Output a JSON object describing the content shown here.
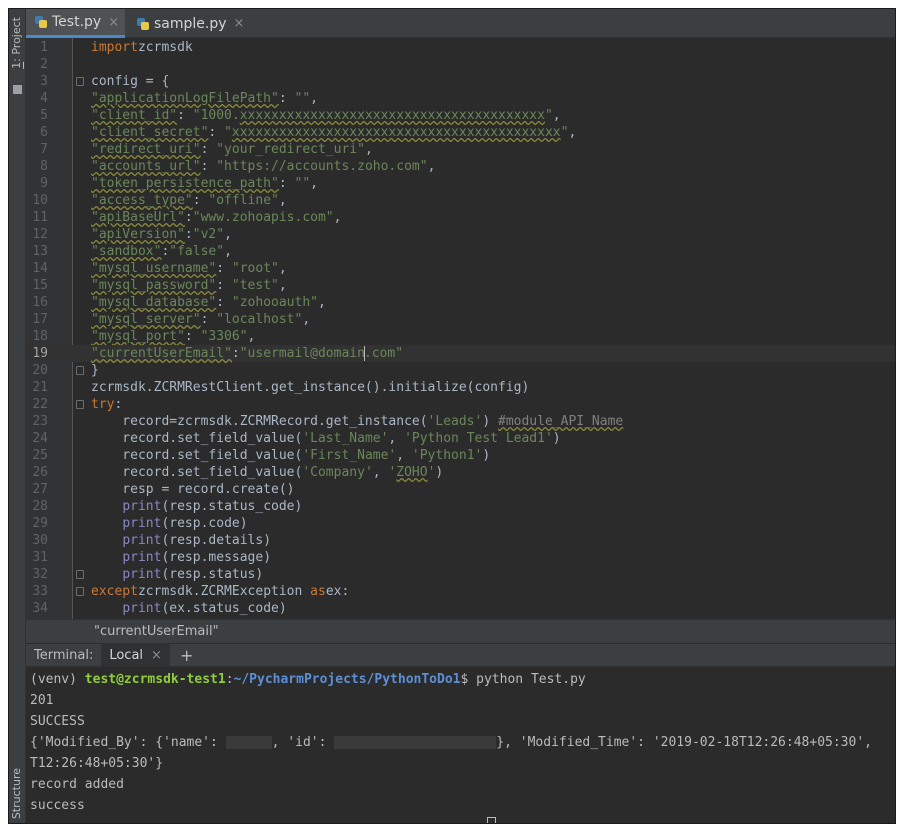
{
  "sidebar": {
    "project_num": "1",
    "project_label": ": Project",
    "structure_label": "Structure"
  },
  "tabs": [
    {
      "label": "Test.py",
      "close": "×"
    },
    {
      "label": "sample.py",
      "close": "×"
    }
  ],
  "editor": {
    "current_line": 19,
    "lines": [
      {
        "n": "1",
        "segs": [
          [
            "kw",
            "import"
          ],
          [
            "",
            "zcrmsdk"
          ]
        ]
      },
      {
        "n": "2",
        "segs": []
      },
      {
        "n": "3",
        "segs": [
          [
            "",
            "config = {"
          ]
        ]
      },
      {
        "n": "4",
        "segs": [
          [
            "sw",
            "\"applicationLogFilePath\""
          ],
          [
            "",
            ": "
          ],
          [
            "str",
            "\"\""
          ],
          [
            "",
            ","
          ]
        ]
      },
      {
        "n": "5",
        "segs": [
          [
            "sw",
            "\"client_id\""
          ],
          [
            "",
            ": "
          ],
          [
            "str",
            "\"1000."
          ],
          [
            "sw",
            "xxxxxxxxxxxxxxxxxxxxxxxxxxxxxxxxxxxxxxx"
          ],
          [
            "str",
            "\""
          ],
          [
            "",
            ","
          ]
        ]
      },
      {
        "n": "6",
        "segs": [
          [
            "sw",
            "\"client_secret\""
          ],
          [
            "",
            ": "
          ],
          [
            "str",
            "\""
          ],
          [
            "sw",
            "xxxxxxxxxxxxxxxxxxxxxxxxxxxxxxxxxxxxxxxxxx"
          ],
          [
            "str",
            "\""
          ],
          [
            "",
            ","
          ]
        ]
      },
      {
        "n": "7",
        "segs": [
          [
            "sw",
            "\"redirect_uri\""
          ],
          [
            "",
            ": "
          ],
          [
            "str",
            "\"your_redirect_uri\""
          ],
          [
            "",
            ","
          ]
        ]
      },
      {
        "n": "8",
        "segs": [
          [
            "sw",
            "\"accounts_url\""
          ],
          [
            "",
            ": "
          ],
          [
            "str",
            "\"https://accounts.zoho.com\""
          ],
          [
            "",
            ","
          ]
        ]
      },
      {
        "n": "9",
        "segs": [
          [
            "sw",
            "\"token_persistence_path\""
          ],
          [
            "",
            ": "
          ],
          [
            "str",
            "\"\""
          ],
          [
            "",
            ","
          ]
        ]
      },
      {
        "n": "10",
        "segs": [
          [
            "sw",
            "\"access_type\""
          ],
          [
            "",
            ": "
          ],
          [
            "str",
            "\"offline\""
          ],
          [
            "",
            ","
          ]
        ]
      },
      {
        "n": "11",
        "segs": [
          [
            "sw",
            "\"apiBaseUrl\""
          ],
          [
            "",
            ":"
          ],
          [
            "str",
            "\"www.zohoapis.com\""
          ],
          [
            "",
            ","
          ]
        ]
      },
      {
        "n": "12",
        "segs": [
          [
            "sw",
            "\"apiVersion\""
          ],
          [
            "",
            ":"
          ],
          [
            "str",
            "\"v2\""
          ],
          [
            "",
            ","
          ]
        ]
      },
      {
        "n": "13",
        "segs": [
          [
            "sw",
            "\"sandbox\""
          ],
          [
            "",
            ":"
          ],
          [
            "str",
            "\"false\""
          ],
          [
            "",
            ","
          ]
        ]
      },
      {
        "n": "14",
        "segs": [
          [
            "sw",
            "\"mysql_username\""
          ],
          [
            "",
            ": "
          ],
          [
            "str",
            "\"root\""
          ],
          [
            "",
            ","
          ]
        ]
      },
      {
        "n": "15",
        "segs": [
          [
            "sw",
            "\"mysql_password\""
          ],
          [
            "",
            ": "
          ],
          [
            "str",
            "\"test\""
          ],
          [
            "",
            ","
          ]
        ]
      },
      {
        "n": "16",
        "segs": [
          [
            "sw",
            "\"mysql_database\""
          ],
          [
            "",
            ": "
          ],
          [
            "str",
            "\"zohooauth\""
          ],
          [
            "",
            ","
          ]
        ]
      },
      {
        "n": "17",
        "segs": [
          [
            "sw",
            "\"mysql_server\""
          ],
          [
            "",
            ": "
          ],
          [
            "str",
            "\"localhost\""
          ],
          [
            "",
            ","
          ]
        ]
      },
      {
        "n": "18",
        "segs": [
          [
            "sw",
            "\"mysql_port\""
          ],
          [
            "",
            ": "
          ],
          [
            "str",
            "\"3306\""
          ],
          [
            "",
            ","
          ]
        ]
      },
      {
        "n": "19",
        "segs": [
          [
            "sw",
            "\"currentUserEmail\""
          ],
          [
            "",
            ":"
          ],
          [
            "str",
            "\"usermail@domain"
          ],
          [
            "caret",
            ""
          ],
          [
            "str",
            ".com\""
          ]
        ]
      },
      {
        "n": "20",
        "segs": [
          [
            "",
            "}"
          ]
        ]
      },
      {
        "n": "21",
        "segs": [
          [
            "",
            "zcrmsdk.ZCRMRestClient.get_instance().initialize(config)"
          ]
        ]
      },
      {
        "n": "22",
        "segs": [
          [
            "kw",
            "try"
          ],
          [
            "",
            ":"
          ]
        ]
      },
      {
        "n": "23",
        "segs": [
          [
            "",
            "    record=zcrmsdk.ZCRMRecord.get_instance("
          ],
          [
            "str",
            "'Leads'"
          ],
          [
            "",
            ") "
          ],
          [
            "cm",
            "#module_API_Name"
          ]
        ]
      },
      {
        "n": "24",
        "segs": [
          [
            "",
            "    record.set_field_value("
          ],
          [
            "str",
            "'Last_Name'"
          ],
          [
            "",
            ", "
          ],
          [
            "str",
            "'Python Test Lead1'"
          ],
          [
            "",
            ")"
          ]
        ]
      },
      {
        "n": "25",
        "segs": [
          [
            "",
            "    record.set_field_value("
          ],
          [
            "str",
            "'First_Name'"
          ],
          [
            "",
            ", "
          ],
          [
            "str",
            "'Python1'"
          ],
          [
            "",
            ")"
          ]
        ]
      },
      {
        "n": "26",
        "segs": [
          [
            "",
            "    record.set_field_value("
          ],
          [
            "str",
            "'Company'"
          ],
          [
            "",
            ", "
          ],
          [
            "str",
            "'"
          ],
          [
            "sw",
            "ZOHO"
          ],
          [
            "str",
            "'"
          ],
          [
            "",
            ")"
          ]
        ]
      },
      {
        "n": "27",
        "segs": [
          [
            "",
            "    resp = record.create()"
          ]
        ]
      },
      {
        "n": "28",
        "segs": [
          [
            "",
            "    "
          ],
          [
            "bi",
            "print"
          ],
          [
            "",
            "(resp.status_code)"
          ]
        ]
      },
      {
        "n": "29",
        "segs": [
          [
            "",
            "    "
          ],
          [
            "bi",
            "print"
          ],
          [
            "",
            "(resp.code)"
          ]
        ]
      },
      {
        "n": "30",
        "segs": [
          [
            "",
            "    "
          ],
          [
            "bi",
            "print"
          ],
          [
            "",
            "(resp.details)"
          ]
        ]
      },
      {
        "n": "31",
        "segs": [
          [
            "",
            "    "
          ],
          [
            "bi",
            "print"
          ],
          [
            "",
            "(resp.message)"
          ]
        ]
      },
      {
        "n": "32",
        "segs": [
          [
            "",
            "    "
          ],
          [
            "bi",
            "print"
          ],
          [
            "",
            "(resp.status)"
          ]
        ]
      },
      {
        "n": "33",
        "segs": [
          [
            "kw",
            "except"
          ],
          [
            "",
            "zcrmsdk.ZCRMException "
          ],
          [
            "kw",
            "as"
          ],
          [
            "",
            "ex:"
          ]
        ]
      },
      {
        "n": "34",
        "segs": [
          [
            "",
            "    "
          ],
          [
            "bi",
            "print"
          ],
          [
            "",
            "(ex.status_code)"
          ]
        ]
      }
    ],
    "fold_lines": [
      3,
      20,
      22,
      32,
      33
    ]
  },
  "breadcrumb": "\"currentUserEmail\"",
  "terminal": {
    "title": "Terminal:",
    "tab": "Local",
    "tab_close": "×",
    "add": "+",
    "prompt": {
      "venv": "(venv) ",
      "user": "test@zcrmsdk-test1",
      "colon": ":",
      "path": "~/PycharmProjects/PythonToDo1",
      "cmd": "$ python Test.py"
    },
    "out_201": "201",
    "out_success_upper": "SUCCESS",
    "dict_a": "{'Modified_By': {'name': ",
    "dict_b": ", 'id': ",
    "dict_c": "}, 'Modified_Time': '2019-02-18T12:26:48+05:30',",
    "dict_wrap": "T12:26:48+05:30'}",
    "record_added": "record added",
    "success": "success"
  },
  "colors": {
    "keyword": "#cc7832",
    "string": "#6a8759",
    "builtin": "#8888c6",
    "comment": "#808080",
    "text": "#a9b7c6",
    "accent": "#4a88c7"
  }
}
